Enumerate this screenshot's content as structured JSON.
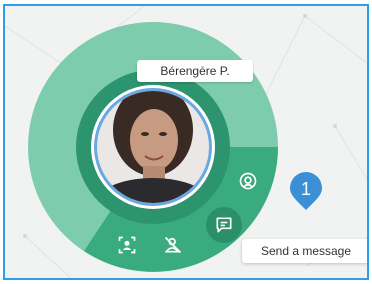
{
  "contact": {
    "name": "Bérengère P.",
    "photo_icon": "avatar-portrait"
  },
  "actions": {
    "call": {
      "icon": "at-sign-icon"
    },
    "message": {
      "icon": "chat-bubble-icon",
      "tooltip": "Send a message"
    },
    "profile": {
      "icon": "user-card-icon"
    },
    "remove": {
      "icon": "person-off-icon"
    }
  },
  "onboarding": {
    "step_number": "1"
  },
  "colors": {
    "frame_border": "#2f9ee8",
    "ring_light": "#7dccad",
    "ring_dark": "#3aab7e",
    "avatar_ring": "#2d9470",
    "button_dark": "#2c8f6c",
    "badge": "#3b8fd6"
  }
}
